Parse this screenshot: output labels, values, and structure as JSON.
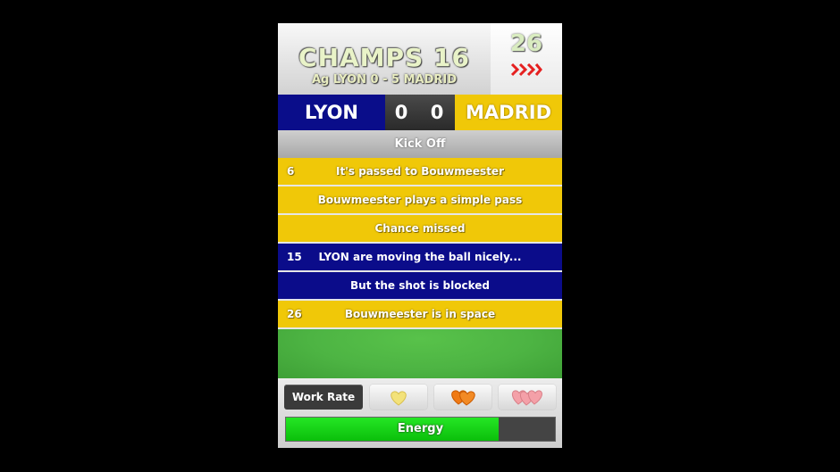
{
  "header": {
    "title": "CHAMPS 16",
    "fixture": "Ag LYON 0 - 5 MADRID",
    "minute": "26"
  },
  "scoreboard": {
    "home_team": "LYON",
    "home_score": "0",
    "away_score": "0",
    "away_team": "MADRID",
    "home_color": "#0a0d8a",
    "away_color": "#f0c808"
  },
  "commentary": {
    "kickoff": "Kick Off",
    "events": [
      {
        "minute": "6",
        "text": "It's passed to Bouwmeester",
        "team": "away"
      },
      {
        "minute": "",
        "text": "Bouwmeester plays a simple pass",
        "team": "away"
      },
      {
        "minute": "",
        "text": "Chance missed",
        "team": "away"
      },
      {
        "minute": "15",
        "text": "LYON are moving the ball nicely...",
        "team": "home"
      },
      {
        "minute": "",
        "text": "But the shot is blocked",
        "team": "home"
      },
      {
        "minute": "26",
        "text": "Bouwmeester is in space",
        "team": "away"
      }
    ]
  },
  "controls": {
    "work_rate_label": "Work Rate",
    "work_rate_options": [
      {
        "icon": "single-heart-icon",
        "color": "#f3e27a"
      },
      {
        "icon": "double-heart-icon",
        "color": "#f07a14"
      },
      {
        "icon": "triple-heart-icon",
        "color": "#f4a0a8"
      }
    ],
    "selected_work_rate": 1,
    "energy_label": "Energy",
    "energy_level": 0.79
  }
}
